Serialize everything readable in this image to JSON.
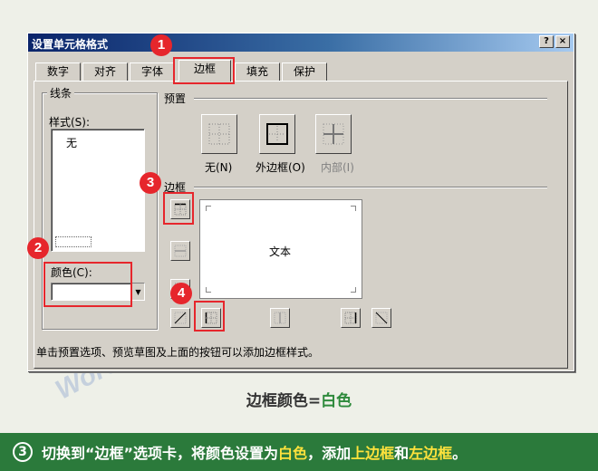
{
  "dialog": {
    "title": "设置单元格格式",
    "help_label": "?",
    "close_label": "×",
    "tabs": [
      "数字",
      "对齐",
      "字体",
      "边框",
      "填充",
      "保护"
    ],
    "active_tab": "边框"
  },
  "line": {
    "group_label": "线条",
    "style_label": "样式(S):",
    "style_none": "无",
    "color_label": "颜色(C):",
    "color_value": ""
  },
  "presets": {
    "group_label": "预置",
    "none_label": "无(N)",
    "outline_label": "外边框(O)",
    "inside_label": "内部(I)"
  },
  "border": {
    "group_label": "边框",
    "preview_text": "文本"
  },
  "hint": "单击预置选项、预览草图及上面的按钮可以添加边框样式。",
  "markers": [
    "1",
    "2",
    "3",
    "4"
  ],
  "caption": {
    "prefix": "边框颜色=",
    "highlight": "白色"
  },
  "footer": {
    "step": "3",
    "t1": "切换到“边框”选项卡，将颜色设置为",
    "h1": "白色",
    "t2": "，添加",
    "h2": "上边框",
    "t3": "和",
    "h3": "左边框",
    "t4": "。"
  },
  "watermark": "Word联盟",
  "colors": {
    "accent_red": "#e6262c",
    "footer_green": "#2b7a3b",
    "highlight_yellow": "#ffe23c",
    "caption_green": "#2e8a3c"
  }
}
